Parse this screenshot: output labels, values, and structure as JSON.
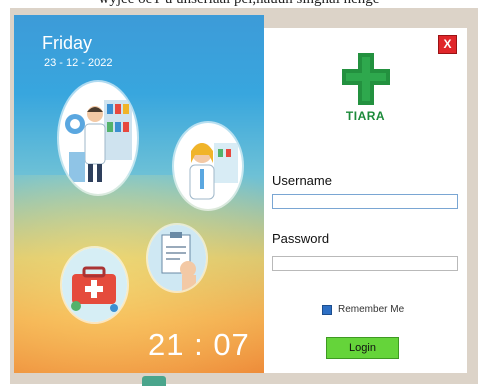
{
  "caption": "wyjee oeT u unseriaai pei,nauun singnai nenge",
  "left": {
    "day": "Friday",
    "date": "23 - 12 - 2022",
    "time": "21 : 07"
  },
  "login": {
    "close_label": "X",
    "brand": "TIARA",
    "username_label": "Username",
    "username_value": "",
    "password_label": "Password",
    "password_value": "",
    "remember_label": "Remember Me",
    "remember_checked": true,
    "login_button": "Login"
  },
  "colors": {
    "close": "#e0262a",
    "login_button": "#65d43a",
    "brand": "#1c8a3a"
  }
}
